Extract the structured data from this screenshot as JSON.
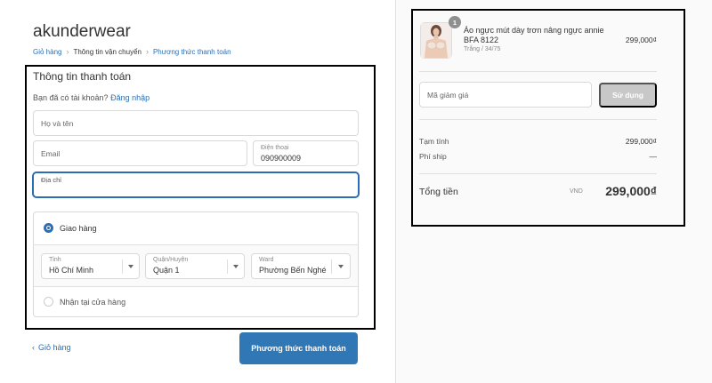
{
  "brand": "akunderwear",
  "breadcrumb": {
    "cart": "Giỏ hàng",
    "shipping": "Thông tin vận chuyển",
    "payment": "Phương thức thanh toán",
    "separator": "›"
  },
  "checkout": {
    "section_title": "Thông tin thanh toán",
    "have_account": "Bạn đã có tài khoản?",
    "login_link": "Đăng nhập",
    "fullname_placeholder": "Họ và tên",
    "email_placeholder": "Email",
    "phone_label": "Điện thoại",
    "phone_value": "090900009",
    "address_placeholder": "Địa chỉ",
    "delivery_option": "Giao hàng",
    "pickup_option": "Nhận tại cửa hàng",
    "province_label": "Tỉnh",
    "province_value": "Hồ Chí Minh",
    "district_label": "Quận/Huyện",
    "district_value": "Quận 1",
    "ward_label": "Ward",
    "ward_value": "Phường Bến Nghé",
    "back_link": "Giỏ hàng",
    "continue_button": "Phương thức thanh toán"
  },
  "summary": {
    "quantity": "1",
    "product_name": "Áo ngực mút dày trơn nâng ngực annie BFA 8122",
    "product_variant": "Trắng / 34/75",
    "product_price": "299,000₫",
    "coupon_placeholder": "Mã giảm giá",
    "apply_button": "Sử dụng",
    "subtotal_label": "Tạm tính",
    "subtotal_value": "299,000₫",
    "shipping_label": "Phí ship",
    "shipping_value": "—",
    "total_label": "Tổng tiền",
    "currency": "VND",
    "total_value": "299,000₫"
  },
  "colors": {
    "accent": "#3077b5",
    "link": "#2a6fb6",
    "apply_disabled": "#c8c8c8"
  }
}
